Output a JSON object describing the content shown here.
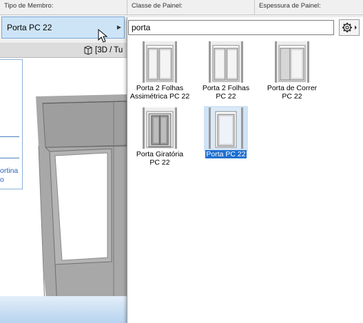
{
  "headers": {
    "member_type": "Tipo de Membro:",
    "panel_class": "Classe de Painel:",
    "panel_thickness": "Espessura de Painel:"
  },
  "member_selector": {
    "value": "Porta PC 22",
    "arrow": "▶"
  },
  "view_tab": {
    "label": "[3D / Tu"
  },
  "left_panel": {
    "line1": "ortina",
    "line2": "o"
  },
  "search": {
    "value": "porta",
    "placeholder": ""
  },
  "items": [
    {
      "name": "Porta 2 Folhas Assimétrica PC 22",
      "line1": "Porta 2 Folhas",
      "line2": "Assimétrica PC 22",
      "selected": false
    },
    {
      "name": "Porta 2 Folhas PC 22",
      "line1": "Porta 2 Folhas",
      "line2": "PC 22",
      "selected": false
    },
    {
      "name": "Porta de Correr PC 22",
      "line1": "Porta de Correr",
      "line2": "PC 22",
      "selected": false
    },
    {
      "name": "Porta Giratória PC 22",
      "line1": "Porta Giratória",
      "line2": "PC 22",
      "selected": false
    },
    {
      "name": "Porta PC 22",
      "line1": "Porta PC 22",
      "line2": "",
      "selected": true
    }
  ],
  "icons": {
    "gear": "gear-icon",
    "cube": "cube-3d-icon",
    "cursor": "mouse-cursor-icon"
  },
  "colors": {
    "selection": "#1e6fd0",
    "selection_bg": "#cfe3f7",
    "selector_bg": "#cde4f7",
    "link_blue": "#2a62b8"
  }
}
